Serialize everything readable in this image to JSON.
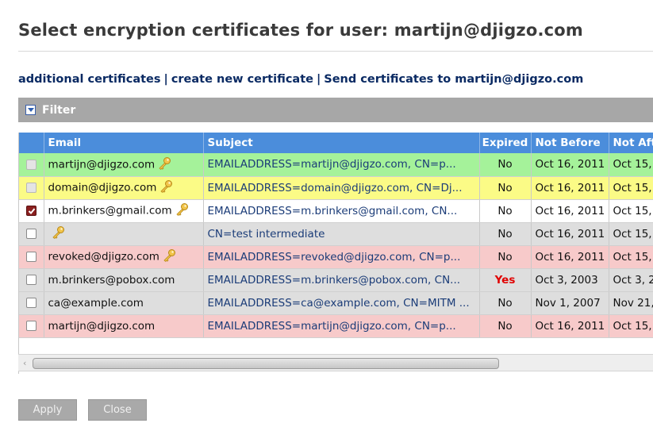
{
  "title": "Select encryption certificates for user: martijn@djigzo.com",
  "links": {
    "additional": "additional certificates",
    "create": "create new certificate",
    "send": "Send certificates to martijn@djigzo.com",
    "separator": "|"
  },
  "filter": {
    "label": "Filter"
  },
  "columns": {
    "email": "Email",
    "subject": "Subject",
    "expired": "Expired",
    "not_before": "Not Before",
    "not_after": "Not Aft"
  },
  "rows": [
    {
      "color": "green",
      "checkbox": "disabled",
      "email": "martijn@djigzo.com",
      "key": true,
      "subject": "EMAILADDRESS=martijn@djigzo.com, CN=p...",
      "expired": "No",
      "not_before": "Oct 16, 2011",
      "not_after": "Oct 15,"
    },
    {
      "color": "yellow",
      "checkbox": "disabled",
      "email": "domain@djigzo.com",
      "key": true,
      "subject": "EMAILADDRESS=domain@djigzo.com, CN=Dj...",
      "expired": "No",
      "not_before": "Oct 16, 2011",
      "not_after": "Oct 15,"
    },
    {
      "color": "white",
      "checkbox": "checked",
      "email": "m.brinkers@gmail.com",
      "key": true,
      "subject": "EMAILADDRESS=m.brinkers@gmail.com, CN...",
      "expired": "No",
      "not_before": "Oct 16, 2011",
      "not_after": "Oct 15,"
    },
    {
      "color": "gray",
      "checkbox": "unchecked",
      "email": "",
      "key": true,
      "subject": "CN=test intermediate",
      "expired": "No",
      "not_before": "Oct 16, 2011",
      "not_after": "Oct 15,"
    },
    {
      "color": "pink",
      "checkbox": "unchecked",
      "email": "revoked@djigzo.com",
      "key": true,
      "subject": "EMAILADDRESS=revoked@djigzo.com, CN=p...",
      "expired": "No",
      "not_before": "Oct 16, 2011",
      "not_after": "Oct 15,"
    },
    {
      "color": "gray",
      "checkbox": "unchecked",
      "email": "m.brinkers@pobox.com",
      "key": false,
      "subject": "EMAILADDRESS=m.brinkers@pobox.com, CN...",
      "expired": "Yes",
      "not_before": "Oct 3, 2003",
      "not_after": "Oct 3, 2"
    },
    {
      "color": "gray",
      "checkbox": "unchecked",
      "email": "ca@example.com",
      "key": false,
      "subject": "EMAILADDRESS=ca@example.com, CN=MITM ...",
      "expired": "No",
      "not_before": "Nov 1, 2007",
      "not_after": "Nov 21,"
    },
    {
      "color": "pink",
      "checkbox": "unchecked",
      "email": "martijn@djigzo.com",
      "key": false,
      "subject": "EMAILADDRESS=martijn@djigzo.com, CN=p...",
      "expired": "No",
      "not_before": "Oct 16, 2011",
      "not_after": "Oct 15,"
    }
  ],
  "colors": {
    "header": "#4b8ddb",
    "green": "#a5f29a",
    "yellow": "#fbfb86",
    "gray": "#dedede",
    "pink": "#f7caca",
    "expired_yes": "#e00000",
    "link": "#0a2a63"
  },
  "icons": {
    "key": "key-icon",
    "filter_toggle": "chevron-down-icon"
  },
  "buttons": {
    "apply": "Apply",
    "close": "Close"
  }
}
